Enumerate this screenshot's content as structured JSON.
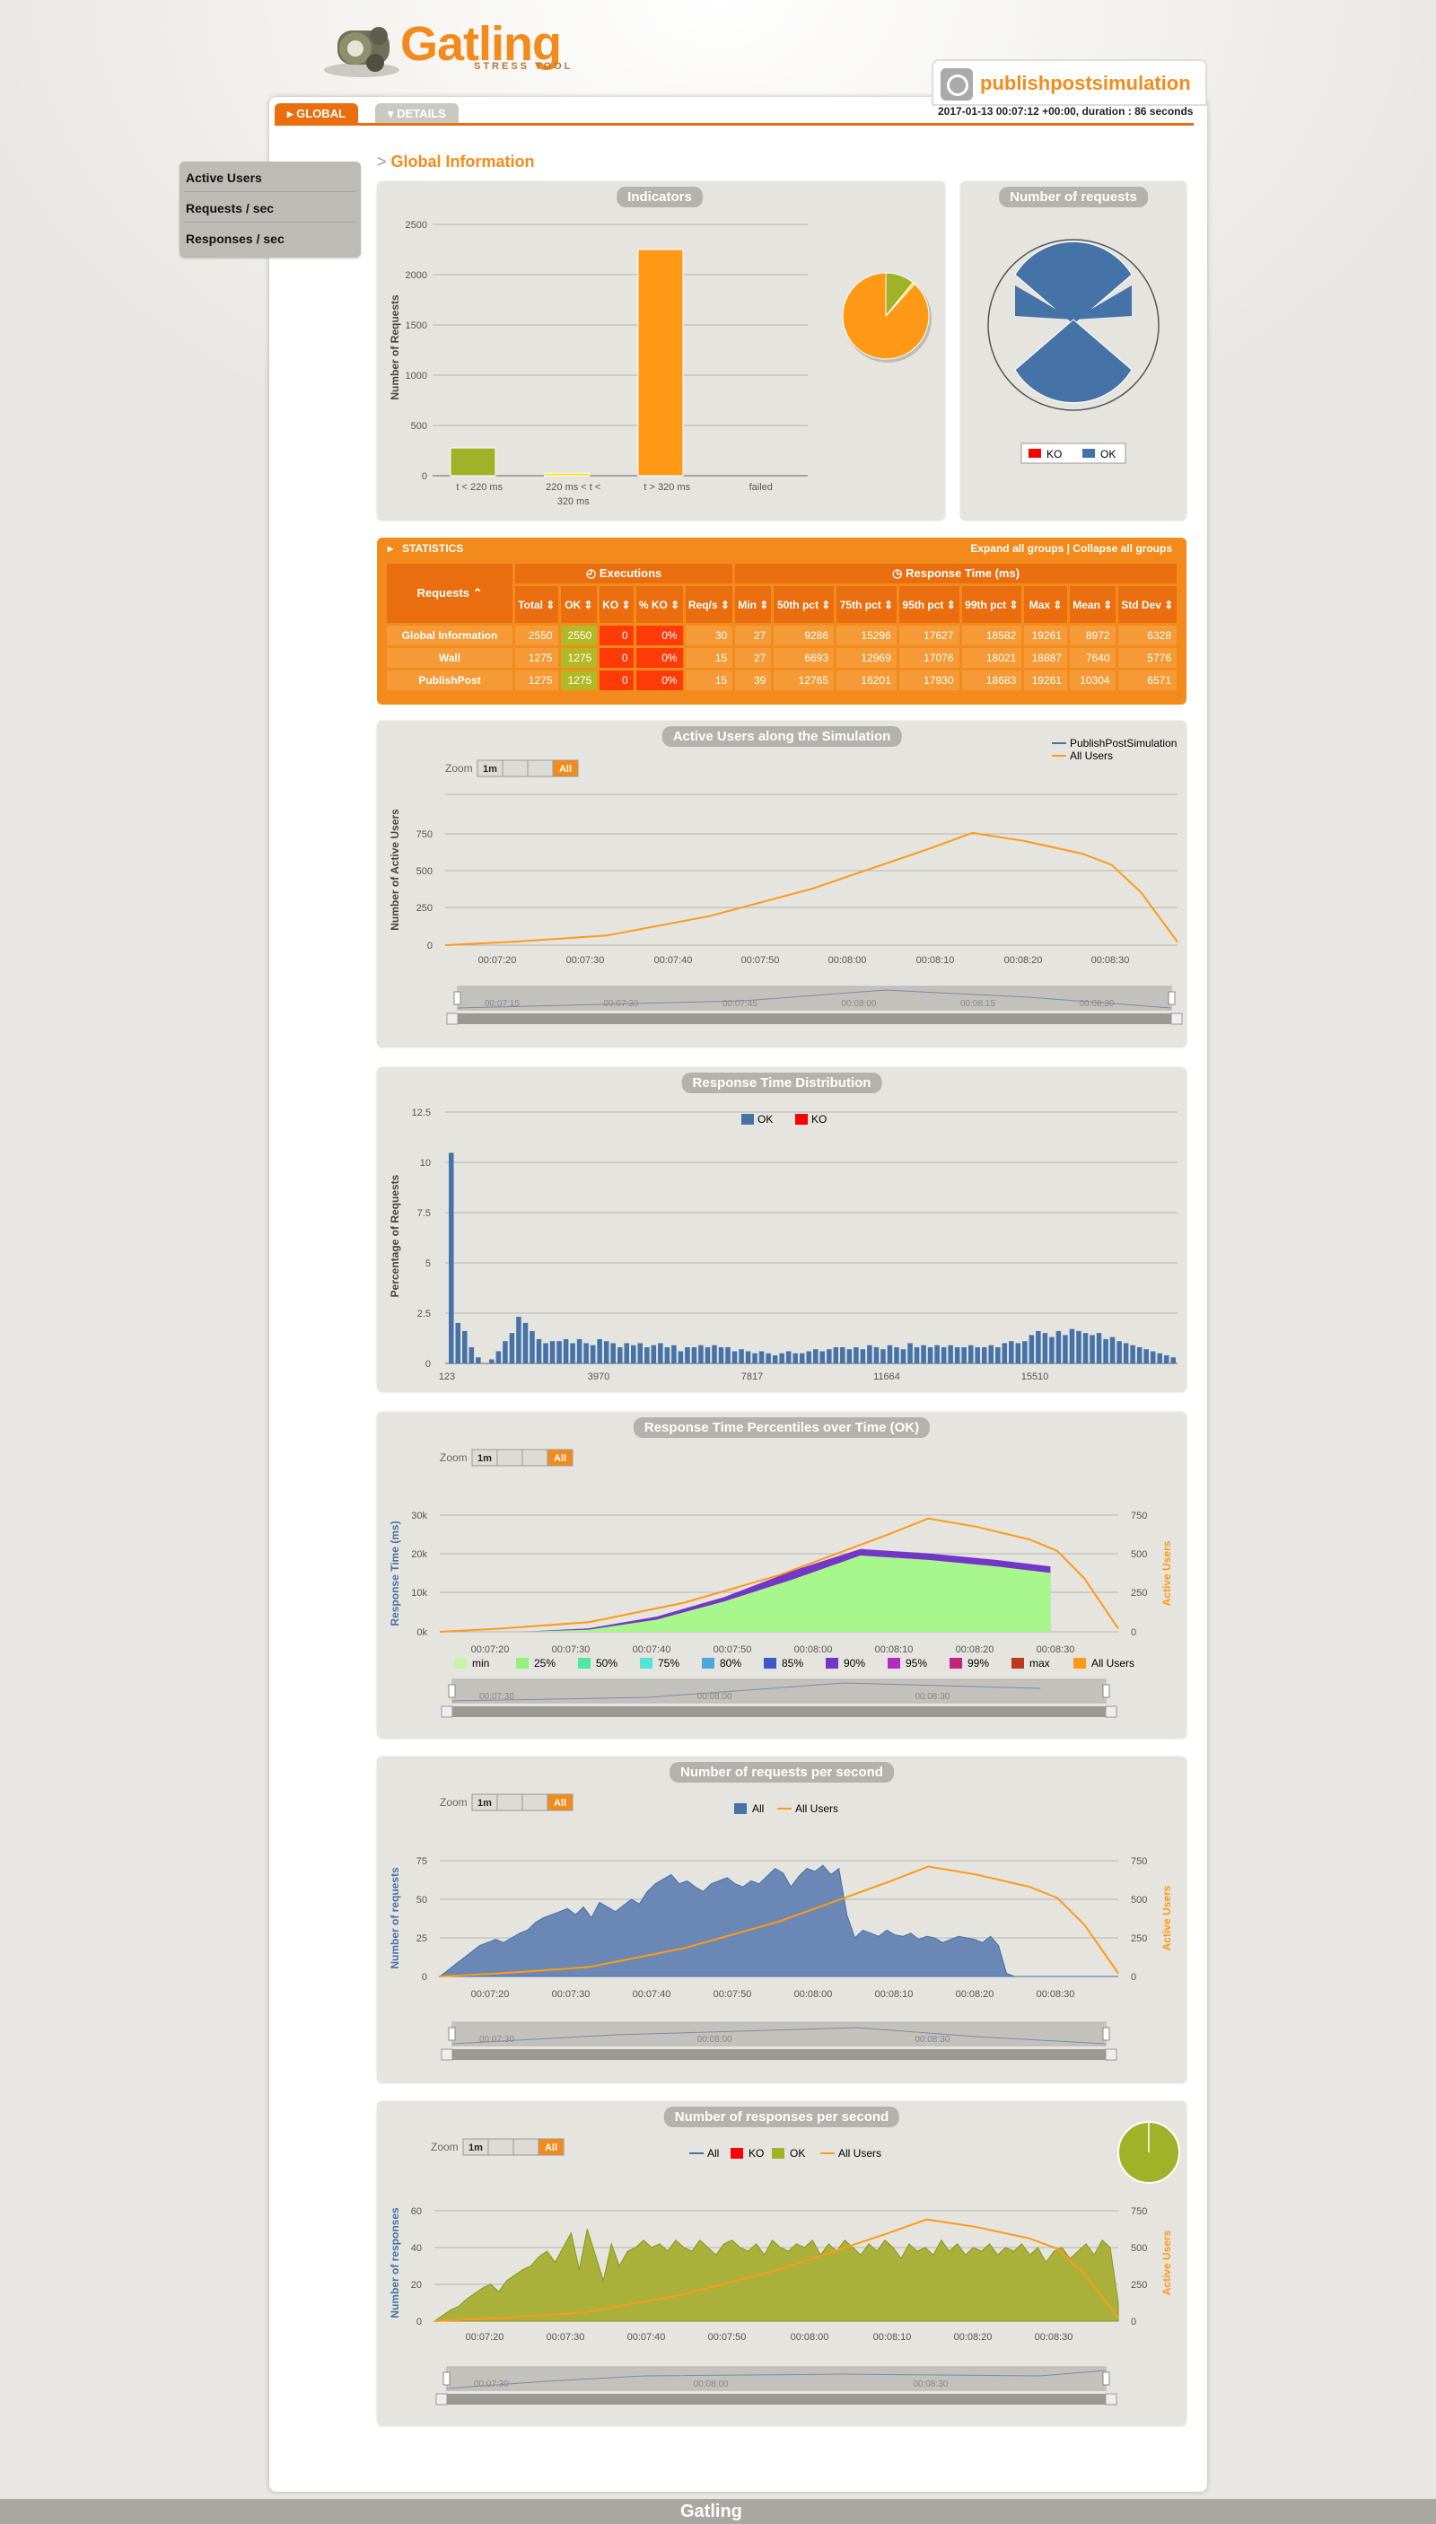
{
  "header": {
    "logo_text": "Gatling",
    "logo_sub": "STRESS TOOL",
    "simulation_name": "publishpostsimulation",
    "date_info": "2017-01-13 00:07:12 +00:00, duration : 86 seconds",
    "tabs": [
      {
        "label": "GLOBAL"
      },
      {
        "label": "DETAILS"
      }
    ]
  },
  "sidebar": {
    "items": [
      {
        "label": "Active Users"
      },
      {
        "label": "Requests / sec"
      },
      {
        "label": "Responses / sec"
      }
    ]
  },
  "section_title": "Global Information",
  "section_arrow": ">",
  "zoom": {
    "label": "Zoom",
    "buttons": [
      "1m",
      "",
      "",
      "All"
    ]
  },
  "colors": {
    "accent": "#f28b1b",
    "ok": "#4572a7",
    "ko": "#ff0000",
    "ok_green": "#a0b228",
    "users": "#ff9916"
  },
  "indicators": {
    "title": "Indicators",
    "ylabel": "Number of Requests",
    "chart_data": {
      "type": "bar",
      "categories": [
        "t < 220 ms",
        "220 ms < t < 320 ms",
        "t > 320 ms",
        "failed"
      ],
      "values": [
        276,
        24,
        2250,
        0
      ],
      "colors": [
        "#a0b228",
        "#ffdd00",
        "#ff9916",
        "#ff0000"
      ],
      "yticks": [
        0,
        500,
        1000,
        1500,
        2000,
        2500
      ],
      "ylim": [
        0,
        2500
      ]
    },
    "pie": {
      "type": "pie",
      "values": [
        276,
        24,
        2250
      ],
      "colors": [
        "#a0b228",
        "#ffdd00",
        "#ff9916"
      ]
    }
  },
  "number_of_requests": {
    "title": "Number of requests",
    "legend": [
      {
        "name": "KO",
        "color": "#ff0000"
      },
      {
        "name": "OK",
        "color": "#4572a7"
      }
    ]
  },
  "statistics": {
    "title": "STATISTICS",
    "links": "Expand all groups | Collapse all groups",
    "col_requests": "Requests ⌃",
    "group_exec": "Executions",
    "group_rt": "Response Time (ms)",
    "columns": [
      "Total ⇕",
      "OK ⇕",
      "KO ⇕",
      "% KO ⇕",
      "Req/s ⇕",
      "Min ⇕",
      "50th pct ⇕",
      "75th pct ⇕",
      "95th pct ⇕",
      "99th pct ⇕",
      "Max ⇕",
      "Mean ⇕",
      "Std Dev ⇕"
    ],
    "rows": [
      {
        "name": "Global Information",
        "values": [
          "2550",
          "2550",
          "0",
          "0%",
          "30",
          "27",
          "9286",
          "15296",
          "17627",
          "18582",
          "19261",
          "8972",
          "6328"
        ]
      },
      {
        "name": "Wall",
        "values": [
          "1275",
          "1275",
          "0",
          "0%",
          "15",
          "27",
          "6693",
          "12969",
          "17076",
          "18021",
          "18887",
          "7640",
          "5776"
        ]
      },
      {
        "name": "PublishPost",
        "values": [
          "1275",
          "1275",
          "0",
          "0%",
          "15",
          "39",
          "12765",
          "16201",
          "17930",
          "18683",
          "19261",
          "10304",
          "6571"
        ]
      }
    ]
  },
  "active_users": {
    "title": "Active Users along the Simulation",
    "ylabel": "Number of Active Users",
    "legend": [
      "PublishPostSimulation",
      "All Users"
    ],
    "chart_data": {
      "type": "line",
      "x": [
        "00:07:12",
        "00:07:20",
        "00:07:30",
        "00:07:40",
        "00:07:50",
        "00:08:00",
        "00:08:04",
        "00:08:10",
        "00:08:20",
        "00:08:25",
        "00:08:30",
        "00:08:38"
      ],
      "series": [
        {
          "name": "All Users",
          "values": [
            0,
            20,
            60,
            180,
            350,
            600,
            700,
            650,
            570,
            500,
            330,
            20
          ]
        }
      ],
      "xticks": [
        "00:07:20",
        "00:07:30",
        "00:07:40",
        "00:07:50",
        "00:08:00",
        "00:08:10",
        "00:08:20",
        "00:08:30"
      ],
      "yticks": [
        0,
        250,
        500,
        750
      ],
      "ylim": [
        0,
        1000
      ]
    },
    "nav_ticks": [
      "00:07:15",
      "00:07:30",
      "00:07:45",
      "00:08:00",
      "00:08:15",
      "00:08:30"
    ]
  },
  "distribution": {
    "title": "Response Time Distribution",
    "ylabel": "Percentage of Requests",
    "legend": [
      {
        "name": "OK",
        "color": "#4572a7"
      },
      {
        "name": "KO",
        "color": "#ff0000"
      }
    ],
    "chart_data": {
      "type": "bar",
      "xticks": [
        "123",
        "3970",
        "7817",
        "11664",
        "15510"
      ],
      "yticks": [
        "0",
        "2.5",
        "5",
        "7.5",
        "10",
        "12.5"
      ],
      "ylim": [
        0,
        12.5
      ],
      "values": [
        10.4,
        2.0,
        1.6,
        0.8,
        0.3,
        0,
        0.2,
        0.6,
        1.1,
        1.5,
        2.3,
        2.0,
        1.6,
        1.2,
        1.0,
        1.1,
        1.1,
        1.2,
        1.0,
        1.2,
        1.0,
        0.9,
        1.2,
        1.1,
        1.0,
        0.8,
        1.0,
        0.9,
        1.0,
        0.8,
        0.9,
        1.0,
        0.8,
        0.9,
        0.6,
        0.8,
        0.8,
        0.9,
        0.8,
        0.9,
        0.8,
        0.8,
        0.6,
        0.7,
        0.6,
        0.5,
        0.6,
        0.5,
        0.4,
        0.5,
        0.6,
        0.5,
        0.5,
        0.6,
        0.7,
        0.6,
        0.7,
        0.8,
        0.8,
        0.7,
        0.8,
        0.7,
        0.9,
        0.8,
        0.7,
        0.9,
        0.8,
        0.7,
        1.0,
        0.8,
        0.9,
        0.8,
        0.9,
        0.8,
        0.9,
        0.8,
        0.8,
        0.9,
        0.8,
        0.8,
        0.9,
        0.8,
        1.0,
        1.1,
        1.0,
        1.1,
        1.4,
        1.6,
        1.5,
        1.3,
        1.6,
        1.4,
        1.7,
        1.6,
        1.5,
        1.4,
        1.5,
        1.2,
        1.3,
        1.1,
        1.0,
        0.9,
        0.8,
        0.7,
        0.6,
        0.5,
        0.4,
        0.3
      ]
    }
  },
  "percentiles": {
    "title": "Response Time Percentiles over Time (OK)",
    "ylabel": "Response Time (ms)",
    "y2label": "Active Users",
    "chart_data": {
      "type": "area",
      "xticks": [
        "00:07:20",
        "00:07:30",
        "00:07:40",
        "00:07:50",
        "00:08:00",
        "00:08:10",
        "00:08:20",
        "00:08:30"
      ],
      "yticks": [
        "0k",
        "10k",
        "20k",
        "30k"
      ],
      "y2ticks": [
        "0",
        "250",
        "500",
        "750"
      ],
      "series": [
        {
          "name": "max",
          "values": [
            0,
            0,
            800,
            3500,
            8000,
            14000,
            19000,
            18000,
            16500,
            15000,
            0
          ]
        },
        {
          "name": "min",
          "values": [
            0,
            0,
            500,
            2800,
            7000,
            12000,
            17500,
            16500,
            15000,
            13500,
            0
          ]
        },
        {
          "name": "All Users",
          "values": [
            0,
            20,
            60,
            180,
            350,
            600,
            700,
            650,
            570,
            500,
            330,
            20
          ]
        }
      ]
    },
    "legend": [
      {
        "name": "min",
        "color": "#c3f7a5"
      },
      {
        "name": "25%",
        "color": "#96f07c"
      },
      {
        "name": "50%",
        "color": "#4fe89c"
      },
      {
        "name": "75%",
        "color": "#52e4d7"
      },
      {
        "name": "80%",
        "color": "#4ca6e0"
      },
      {
        "name": "85%",
        "color": "#3a5bc4"
      },
      {
        "name": "90%",
        "color": "#7436c6"
      },
      {
        "name": "95%",
        "color": "#b52bc1"
      },
      {
        "name": "99%",
        "color": "#c4227d"
      },
      {
        "name": "max",
        "color": "#c0381a"
      },
      {
        "name": "All Users",
        "color": "#ff9916"
      }
    ],
    "nav_ticks": [
      "00:07:30",
      "00:08:00",
      "00:08:30"
    ]
  },
  "reqs_per_sec": {
    "title": "Number of requests per second",
    "ylabel": "Number of requests",
    "y2label": "Active Users",
    "legend": [
      "All",
      "All Users"
    ],
    "chart_data": {
      "type": "area",
      "xticks": [
        "00:07:20",
        "00:07:30",
        "00:07:40",
        "00:07:50",
        "00:08:00",
        "00:08:10",
        "00:08:20",
        "00:08:30"
      ],
      "yticks": [
        "0",
        "25",
        "50",
        "75"
      ],
      "y2ticks": [
        "0",
        "250",
        "500",
        "750"
      ],
      "series": [
        {
          "name": "All",
          "values": [
            0,
            4,
            8,
            12,
            16,
            20,
            22,
            24,
            22,
            25,
            28,
            30,
            35,
            38,
            40,
            42,
            44,
            40,
            45,
            38,
            48,
            45,
            42,
            46,
            50,
            47,
            55,
            60,
            63,
            66,
            60,
            62,
            58,
            55,
            60,
            62,
            64,
            60,
            58,
            62,
            60,
            65,
            70,
            67,
            58,
            65,
            70,
            68,
            72,
            66,
            70,
            40,
            25,
            30,
            28,
            26,
            30,
            27,
            26,
            28,
            24,
            26,
            25,
            22,
            24,
            26,
            25,
            24,
            22,
            26,
            20,
            2,
            0,
            0,
            0,
            0,
            0,
            0,
            0,
            0,
            0,
            0,
            0,
            0,
            0,
            0
          ]
        },
        {
          "name": "All Users",
          "values": [
            0,
            20,
            60,
            180,
            350,
            600,
            700,
            650,
            570,
            500,
            330,
            20
          ]
        }
      ]
    },
    "nav_ticks": [
      "00:07:30",
      "00:08:00",
      "00:08:30"
    ]
  },
  "responses_per_sec": {
    "title": "Number of responses per second",
    "ylabel": "Number of responses",
    "y2label": "Active Users",
    "legend": [
      {
        "name": "All",
        "color": "#4572a7"
      },
      {
        "name": "KO",
        "color": "#ff0000"
      },
      {
        "name": "OK",
        "color": "#a0b228"
      },
      {
        "name": "All Users",
        "color": "#ff9916"
      }
    ],
    "chart_data": {
      "type": "area",
      "xticks": [
        "00:07:20",
        "00:07:30",
        "00:07:40",
        "00:07:50",
        "00:08:00",
        "00:08:10",
        "00:08:20",
        "00:08:30"
      ],
      "yticks": [
        "0",
        "20",
        "40",
        "60"
      ],
      "y2ticks": [
        "0",
        "250",
        "500",
        "750"
      ],
      "series": [
        {
          "name": "OK",
          "values": [
            0,
            3,
            6,
            8,
            12,
            15,
            18,
            20,
            16,
            22,
            25,
            28,
            30,
            35,
            38,
            32,
            40,
            48,
            28,
            50,
            36,
            22,
            42,
            30,
            38,
            40,
            44,
            40,
            42,
            38,
            44,
            40,
            38,
            44,
            40,
            36,
            42,
            44,
            40,
            38,
            42,
            36,
            44,
            40,
            38,
            42,
            40,
            44,
            36,
            42,
            38,
            44,
            40,
            36,
            42,
            38,
            44,
            40,
            34,
            42,
            38,
            40,
            36,
            44,
            38,
            42,
            36,
            40,
            38,
            42,
            36,
            40,
            38,
            42,
            36,
            40,
            32,
            38,
            40,
            34,
            38,
            42,
            36,
            44,
            40,
            10
          ]
        },
        {
          "name": "All Users",
          "values": [
            0,
            20,
            60,
            180,
            350,
            600,
            700,
            650,
            570,
            500,
            330,
            20
          ]
        }
      ]
    },
    "nav_ticks": [
      "00:07:30",
      "00:08:00",
      "00:08:30"
    ]
  },
  "footer": {
    "logo": "Gatling"
  }
}
